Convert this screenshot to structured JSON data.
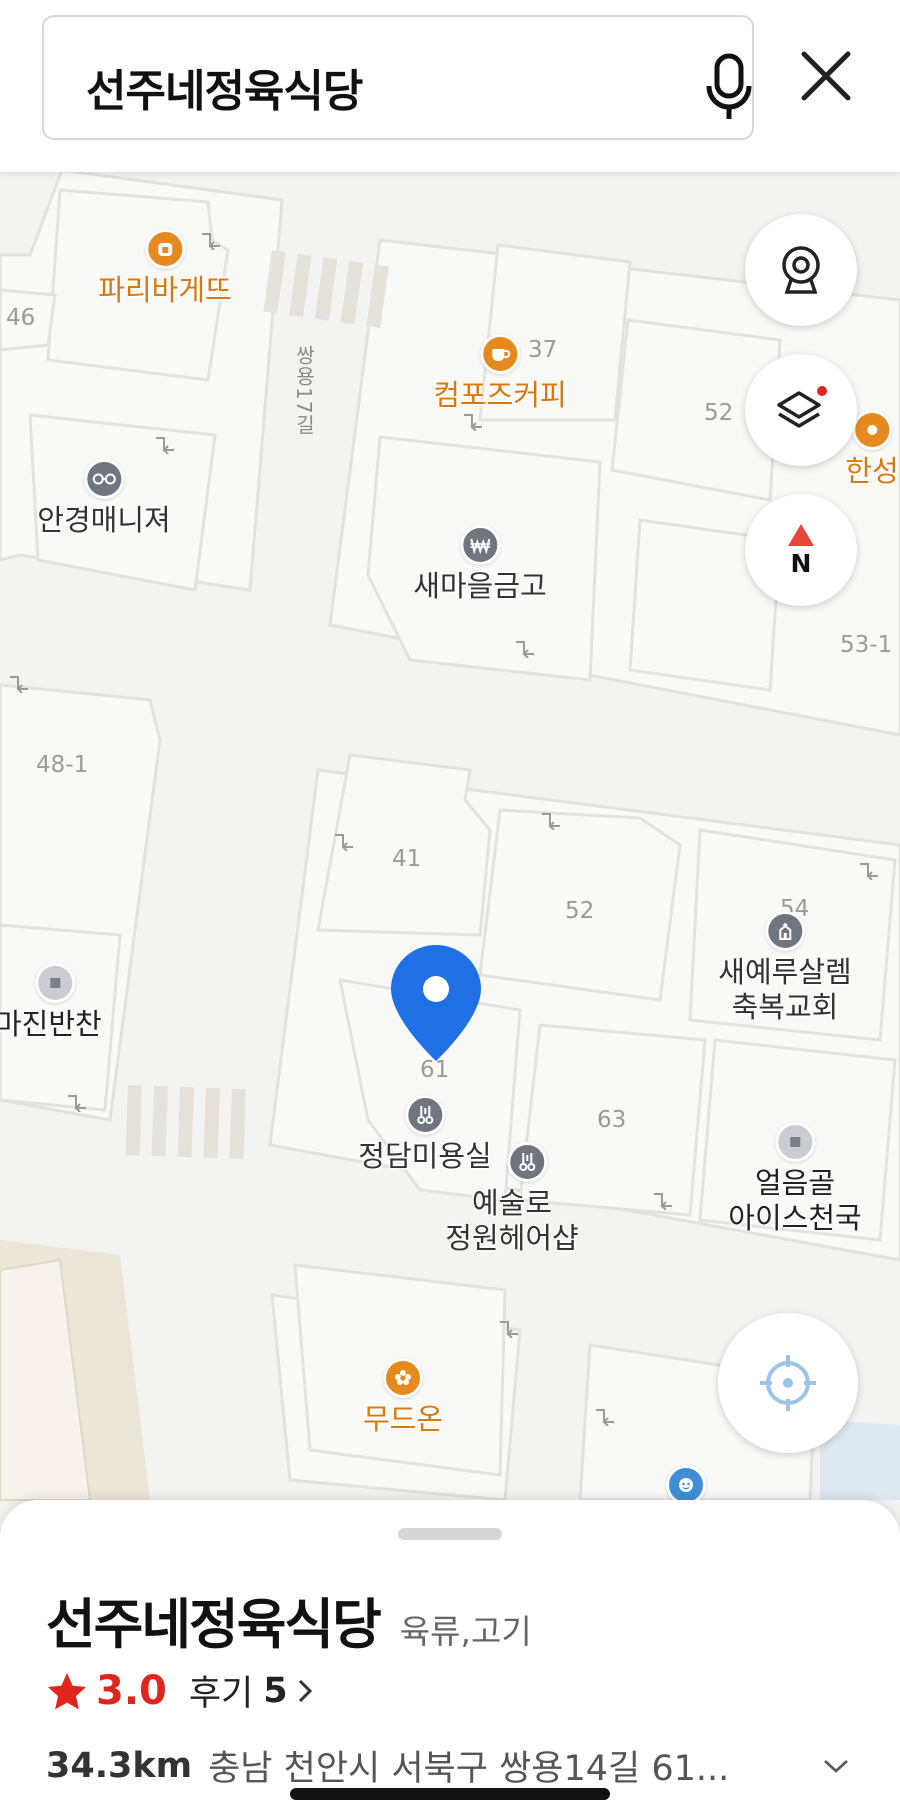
{
  "search": {
    "query": "선주네정육식당"
  },
  "map": {
    "block_numbers": [
      "46",
      "37",
      "52",
      "53-1",
      "48-1",
      "41",
      "52",
      "54",
      "61",
      "63"
    ],
    "road_names": [
      "쌍용17길"
    ],
    "pois": [
      {
        "name": "파리바게뜨",
        "icon": "bakery-icon",
        "color": "#e58a1f"
      },
      {
        "name": "컴포즈커피",
        "icon": "coffee-icon",
        "color": "#e58a1f"
      },
      {
        "name": "한성",
        "icon": "restaurant-icon",
        "color": "#e58a1f"
      },
      {
        "name": "안경매니져",
        "icon": "glasses-icon",
        "color": "#6f7680"
      },
      {
        "name": "새마을금고",
        "icon": "bank-icon",
        "color": "#6f7680"
      },
      {
        "name": "엄마진반찬",
        "icon": "store-icon",
        "color": "#c9cdd2"
      },
      {
        "name": "새예루살렘\n축복교회",
        "icon": "church-icon",
        "color": "#6f7680"
      },
      {
        "name": "정담미용실",
        "icon": "hair-salon-icon",
        "color": "#6f7680"
      },
      {
        "name": "예술로\n정원헤어샵",
        "icon": "hair-salon-icon",
        "color": "#6f7680"
      },
      {
        "name": "얼음골\n아이스천국",
        "icon": "store-icon",
        "color": "#c9cdd2"
      },
      {
        "name": "무드온",
        "icon": "flower-icon",
        "color": "#e58a1f"
      },
      {
        "name": "",
        "icon": "kids-icon",
        "color": "#3f8fd6"
      }
    ],
    "selected_marker_color": "#1f6fe5"
  },
  "controls": {
    "cctv_icon": "cctv-icon",
    "layers_icon": "layers-icon",
    "compass_label": "N",
    "locate_icon": "crosshair-icon"
  },
  "place": {
    "name": "선주네정육식당",
    "category": "육류,고기",
    "rating": "3.0",
    "review_label": "후기",
    "review_count": "5",
    "distance": "34.3km",
    "address": "충남 천안시 서북구 쌍용14길 61..."
  },
  "colors": {
    "accent_red": "#e0261c",
    "poi_orange": "#e58a1f",
    "marker_blue": "#1f6fe5"
  }
}
